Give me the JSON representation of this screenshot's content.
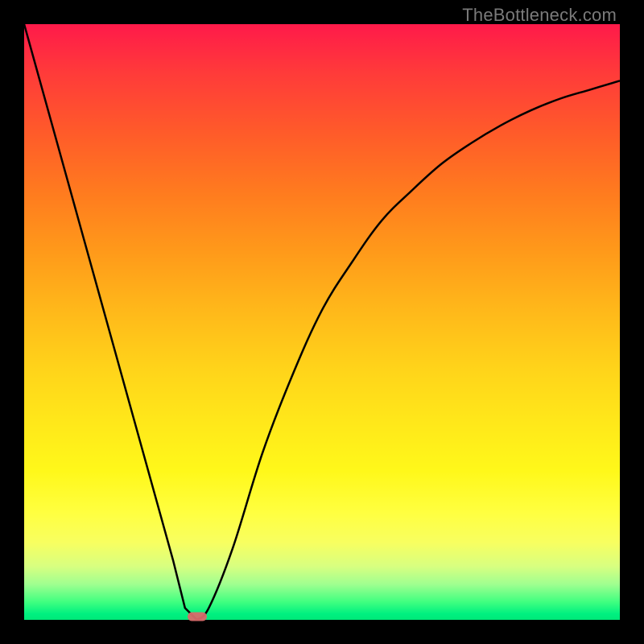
{
  "attribution": "TheBottleneck.com",
  "chart_data": {
    "type": "line",
    "title": "",
    "xlabel": "",
    "ylabel": "",
    "xlim": [
      0,
      100
    ],
    "ylim": [
      0,
      100
    ],
    "x": [
      0,
      5,
      10,
      15,
      20,
      25,
      27,
      29,
      31,
      35,
      40,
      45,
      50,
      55,
      60,
      65,
      70,
      75,
      80,
      85,
      90,
      95,
      100
    ],
    "values": [
      100,
      82,
      64,
      46,
      28,
      10,
      2,
      0,
      2,
      12,
      28,
      41,
      52,
      60,
      67,
      72,
      76.5,
      80,
      83,
      85.5,
      87.5,
      89,
      90.5
    ],
    "minimum_x": 29,
    "minimum_y": 0,
    "marker": {
      "x": 29,
      "y": 0.6
    },
    "curve_color": "#000000",
    "stroke_width": 2.5
  }
}
